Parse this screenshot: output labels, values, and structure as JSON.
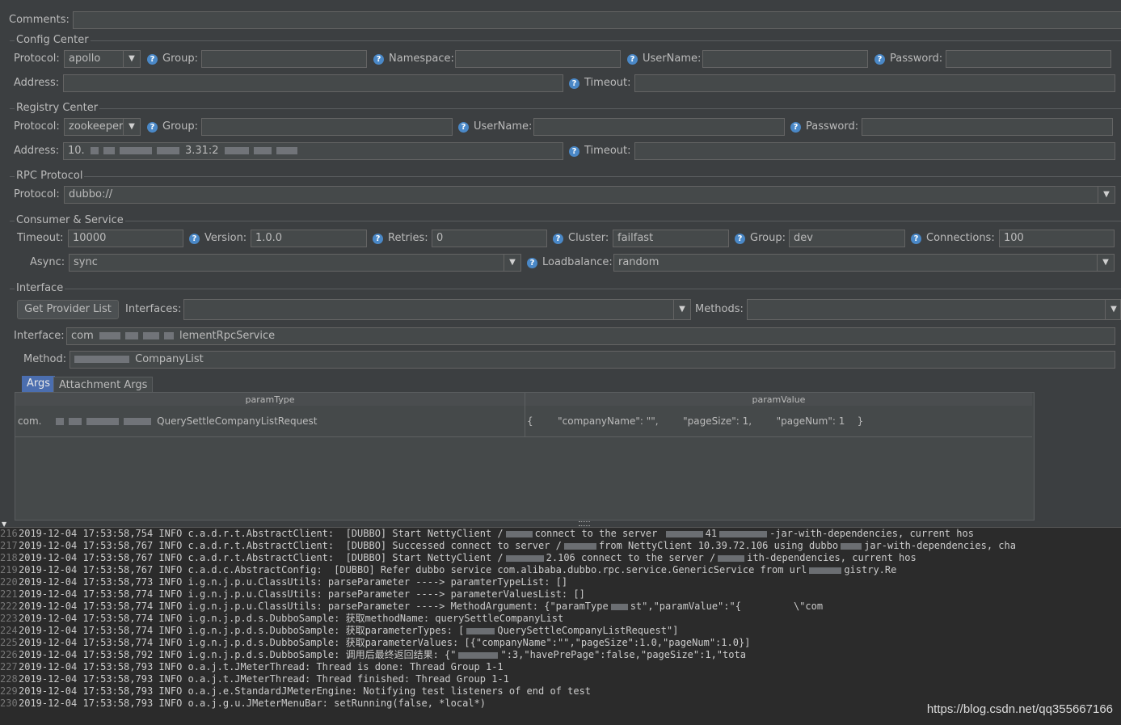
{
  "comments": {
    "label": "Comments:",
    "value": ""
  },
  "config_center": {
    "title": "Config Center",
    "protocol_label": "Protocol:",
    "protocol_value": "apollo",
    "group_label": "Group:",
    "group_value": "",
    "namespace_label": "Namespace:",
    "namespace_value": "",
    "username_label": "UserName:",
    "username_value": "",
    "password_label": "Password:",
    "password_value": "",
    "address_label": "Address:",
    "address_value": "",
    "timeout_label": "Timeout:",
    "timeout_value": ""
  },
  "registry_center": {
    "title": "Registry Center",
    "protocol_label": "Protocol:",
    "protocol_value": "zookeeper",
    "group_label": "Group:",
    "group_value": "",
    "username_label": "UserName:",
    "username_value": "",
    "password_label": "Password:",
    "password_value": "",
    "address_label": "Address:",
    "address_prefix": "10.",
    "address_mid": "3.31:2",
    "timeout_label": "Timeout:",
    "timeout_value": ""
  },
  "rpc_protocol": {
    "title": "RPC Protocol",
    "protocol_label": "Protocol:",
    "protocol_value": "dubbo://"
  },
  "consumer_service": {
    "title": "Consumer & Service",
    "timeout_label": "Timeout:",
    "timeout_value": "10000",
    "version_label": "Version:",
    "version_value": "1.0.0",
    "retries_label": "Retries:",
    "retries_value": "0",
    "cluster_label": "Cluster:",
    "cluster_value": "failfast",
    "group_label": "Group:",
    "group_value": "dev",
    "connections_label": "Connections:",
    "connections_value": "100",
    "async_label": "Async:",
    "async_value": "sync",
    "loadbalance_label": "Loadbalance:",
    "loadbalance_value": "random"
  },
  "interface": {
    "title": "Interface",
    "get_provider_button": "Get Provider List",
    "interfaces_label": "Interfaces:",
    "interfaces_value": "",
    "methods_label": "Methods:",
    "methods_value": "",
    "interface_label": "Interface:",
    "interface_prefix": "com",
    "interface_suffix": "lementRpcService",
    "method_label": "Method:",
    "method_suffix": "CompanyList",
    "tabs": [
      "Args",
      "Attachment Args"
    ],
    "args_table": {
      "headers": [
        "paramType",
        "paramValue"
      ],
      "row_type_prefix": "com.",
      "row_type_suffix": "QuerySettleCompanyListRequest",
      "row_value": "{        \"companyName\": \"\",        \"pageSize\": 1,        \"pageNum\": 1    }"
    }
  },
  "help_icon_glyph": "?",
  "log": {
    "lines": [
      {
        "n": "216",
        "pre": "2019-12-04 17:53:58,754 INFO c.a.d.r.t.AbstractClient:  [DUBBO] Start NettyClient /",
        "mid": "connect to the server ",
        "post": "41",
        "tail": "-jar-with-dependencies, current hos"
      },
      {
        "n": "217",
        "pre": "2019-12-04 17:53:58,767 INFO c.a.d.r.t.AbstractClient:  [DUBBO] Successed connect to server /",
        "mid": "from NettyClient 10.39.72.106 using dubbo",
        "post": "",
        "tail": "jar-with-dependencies, cha"
      },
      {
        "n": "218",
        "pre": "2019-12-04 17:53:58,767 INFO c.a.d.r.t.AbstractClient:  [DUBBO] Start NettyClient /",
        "mid": "2.106 connect to the server /",
        "post": "",
        "tail": "ith-dependencies, current hos"
      },
      {
        "n": "219",
        "pre": "2019-12-04 17:53:58,767 INFO c.a.d.c.AbstractConfig:  [DUBBO] Refer dubbo service com.alibaba.dubbo.rpc.service.GenericService from url",
        "mid": "",
        "post": "",
        "tail": "gistry.Re"
      },
      {
        "n": "220",
        "pre": "2019-12-04 17:53:58,773 INFO i.g.n.j.p.u.ClassUtils: parseParameter ----> paramterTypeList: []",
        "mid": "",
        "post": "",
        "tail": ""
      },
      {
        "n": "221",
        "pre": "2019-12-04 17:53:58,774 INFO i.g.n.j.p.u.ClassUtils: parseParameter ----> parameterValuesList: []",
        "mid": "",
        "post": "",
        "tail": ""
      },
      {
        "n": "222",
        "pre": "2019-12-04 17:53:58,774 INFO i.g.n.j.p.u.ClassUtils: parseParameter ----> MethodArgument: {\"paramType",
        "mid": "",
        "post": "",
        "tail": "st\",\"paramValue\":\"{         \\\"com"
      },
      {
        "n": "223",
        "pre": "2019-12-04 17:53:58,774 INFO i.g.n.j.p.d.s.DubboSample: 获取methodName: querySettleCompanyList",
        "mid": "",
        "post": "",
        "tail": ""
      },
      {
        "n": "224",
        "pre": "2019-12-04 17:53:58,774 INFO i.g.n.j.p.d.s.DubboSample: 获取parameterTypes: [",
        "mid": "",
        "post": "",
        "tail": "QuerySettleCompanyListRequest\"]"
      },
      {
        "n": "225",
        "pre": "2019-12-04 17:53:58,774 INFO i.g.n.j.p.d.s.DubboSample: 获取parameterValues: [{\"companyName\":\"\",\"pageSize\":1.0,\"pageNum\":1.0}]",
        "mid": "",
        "post": "",
        "tail": ""
      },
      {
        "n": "226",
        "pre": "2019-12-04 17:53:58,792 INFO i.g.n.j.p.d.s.DubboSample: 调用后最终返回结果: {\"",
        "mid": "",
        "post": "",
        "tail": "\":3,\"havePrePage\":false,\"pageSize\":1,\"tota"
      },
      {
        "n": "227",
        "pre": "2019-12-04 17:53:58,793 INFO o.a.j.t.JMeterThread: Thread is done: Thread Group 1-1",
        "mid": "",
        "post": "",
        "tail": ""
      },
      {
        "n": "228",
        "pre": "2019-12-04 17:53:58,793 INFO o.a.j.t.JMeterThread: Thread finished: Thread Group 1-1",
        "mid": "",
        "post": "",
        "tail": ""
      },
      {
        "n": "229",
        "pre": "2019-12-04 17:53:58,793 INFO o.a.j.e.StandardJMeterEngine: Notifying test listeners of end of test",
        "mid": "",
        "post": "",
        "tail": ""
      },
      {
        "n": "230",
        "pre": "2019-12-04 17:53:58,793 INFO o.a.j.g.u.JMeterMenuBar: setRunning(false, *local*)",
        "mid": "",
        "post": "",
        "tail": ""
      }
    ]
  },
  "watermark": "https://blog.csdn.net/qq355667166"
}
